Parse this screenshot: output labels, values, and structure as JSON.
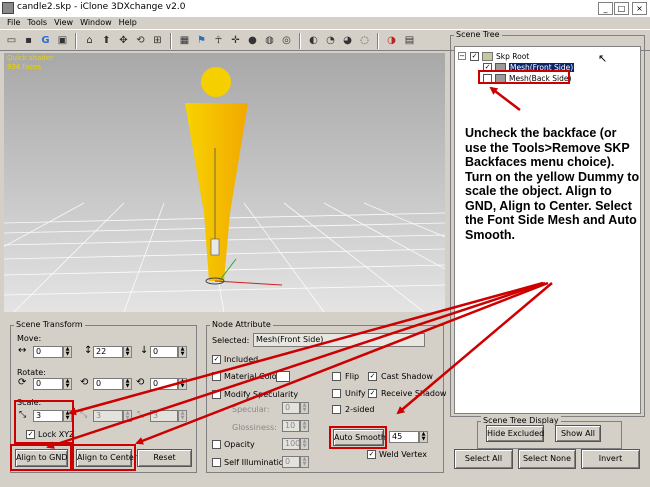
{
  "window": {
    "title": "candle2.skp - iClone 3DXchange v2.0",
    "btn_min": "_",
    "btn_max": "□",
    "btn_close": "×"
  },
  "menu": [
    "File",
    "Tools",
    "View",
    "Window",
    "Help"
  ],
  "viewport": {
    "info": "Quick shader\n934 faces"
  },
  "scene_tree": {
    "title": "Scene Tree",
    "root_label": "Skp Root",
    "nodes": [
      {
        "label": "Mesh(Front Side)",
        "checked": true
      },
      {
        "label": "Mesh(Back Side)",
        "checked": false
      }
    ],
    "display_title": "Scene Tree Display",
    "hide_excluded": "Hide Excluded",
    "show_all": "Show All",
    "select_all": "Select All",
    "select_none": "Select None",
    "invert": "Invert"
  },
  "instructions": "Uncheck the backface (or use the Tools>Remove SKP Backfaces menu choice). Turn on the yellow Dummy to scale the object. Align to GND, Align to Center. Select the Font Side Mesh and Auto Smooth.",
  "scene_transform": {
    "title": "Scene Transform",
    "move_label": "Move:",
    "move": [
      "0",
      "22",
      "0"
    ],
    "rotate_label": "Rotate:",
    "rotate": [
      "0",
      "0",
      "0"
    ],
    "scale_label": "Scale:",
    "scale": [
      "3",
      "3",
      "3"
    ],
    "lock_xyz": "Lock XYZ",
    "align_gnd": "Align to GND",
    "align_center": "Align to Center",
    "reset": "Reset"
  },
  "node_attribute": {
    "title": "Node Attribute",
    "selected_label": "Selected:",
    "selected_value": "Mesh(Front Side)",
    "included": "Included",
    "material_color": "Material Color",
    "modify_specularity": "Modify Specularity",
    "specular": "Specular:",
    "specular_value": "0",
    "glossiness": "Glossiness:",
    "glossiness_value": "10",
    "opacity": "Opacity",
    "opacity_value": "100",
    "self_illumination": "Self Illumination",
    "self_illumination_value": "0",
    "flip": "Flip",
    "unify": "Unify",
    "two_sided": "2-sided",
    "cast_shadow": "Cast Shadow",
    "receive_shadow": "Receive Shadow",
    "auto_smooth": "Auto Smooth",
    "auto_smooth_value": "45",
    "weld_vertex": "Weld Vertex"
  },
  "colors": {
    "annotation": "#cc0000",
    "dummy": "#f4c400",
    "selection": "#0a246a"
  }
}
